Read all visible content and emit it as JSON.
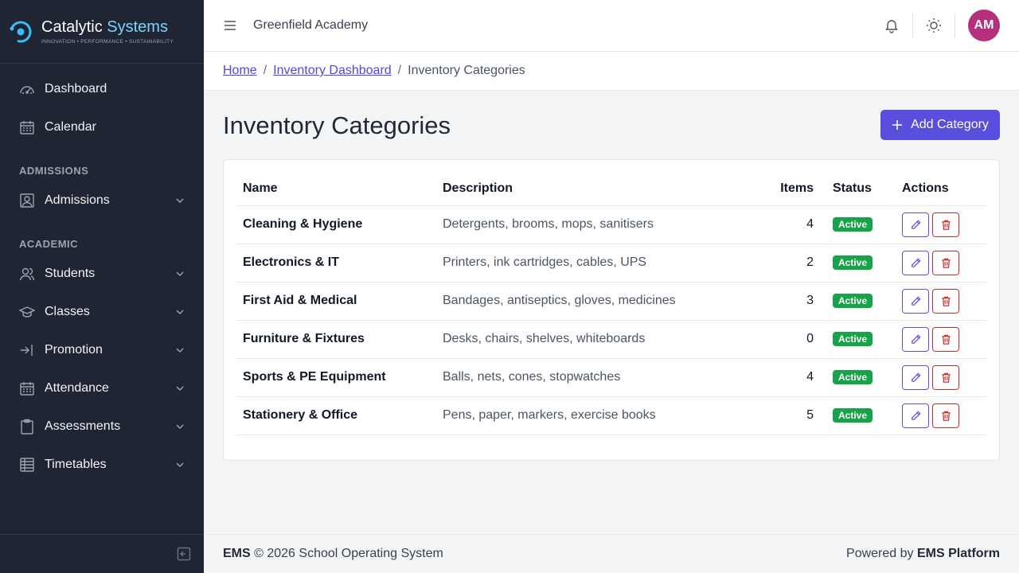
{
  "brand": {
    "name_part1": "Catalytic",
    "name_part2": "Systems",
    "tagline": "INNOVATION • PERFORMANCE • SUSTAINABILITY",
    "accent_color": "#7dd3fc"
  },
  "sidebar": {
    "items_top": [
      {
        "label": "Dashboard",
        "icon": "gauge-icon"
      },
      {
        "label": "Calendar",
        "icon": "calendar-icon"
      }
    ],
    "section_admissions": "ADMISSIONS",
    "admissions": {
      "label": "Admissions",
      "icon": "admissions-icon"
    },
    "section_academic": "ACADEMIC",
    "academic_items": [
      {
        "label": "Students",
        "icon": "students-icon"
      },
      {
        "label": "Classes",
        "icon": "graduation-cap-icon"
      },
      {
        "label": "Promotion",
        "icon": "promotion-icon"
      },
      {
        "label": "Attendance",
        "icon": "calendar-grid-icon"
      },
      {
        "label": "Assessments",
        "icon": "clipboard-icon"
      },
      {
        "label": "Timetables",
        "icon": "table-icon"
      }
    ]
  },
  "header": {
    "school_name": "Greenfield Academy",
    "avatar_initials": "AM",
    "avatar_color": "#b5317e"
  },
  "breadcrumb": {
    "home": "Home",
    "separator": "/",
    "dashboard": "Inventory Dashboard",
    "current": "Inventory Categories"
  },
  "page": {
    "title": "Inventory Categories",
    "add_button": "Add Category",
    "primary_color": "#5a4fdc"
  },
  "table": {
    "headers": {
      "name": "Name",
      "description": "Description",
      "items": "Items",
      "status": "Status",
      "actions": "Actions"
    },
    "rows": [
      {
        "name": "Cleaning & Hygiene",
        "description": "Detergents, brooms, mops, sanitisers",
        "items": "4",
        "status": "Active"
      },
      {
        "name": "Electronics & IT",
        "description": "Printers, ink cartridges, cables, UPS",
        "items": "2",
        "status": "Active"
      },
      {
        "name": "First Aid & Medical",
        "description": "Bandages, antiseptics, gloves, medicines",
        "items": "3",
        "status": "Active"
      },
      {
        "name": "Furniture & Fixtures",
        "description": "Desks, chairs, shelves, whiteboards",
        "items": "0",
        "status": "Active"
      },
      {
        "name": "Sports & PE Equipment",
        "description": "Balls, nets, cones, stopwatches",
        "items": "4",
        "status": "Active"
      },
      {
        "name": "Stationery & Office",
        "description": "Pens, paper, markers, exercise books",
        "items": "5",
        "status": "Active"
      }
    ]
  },
  "footer": {
    "brand": "EMS",
    "copyright": "© 2026 School Operating System",
    "powered_prefix": "Powered by",
    "powered_brand": "EMS Platform"
  }
}
